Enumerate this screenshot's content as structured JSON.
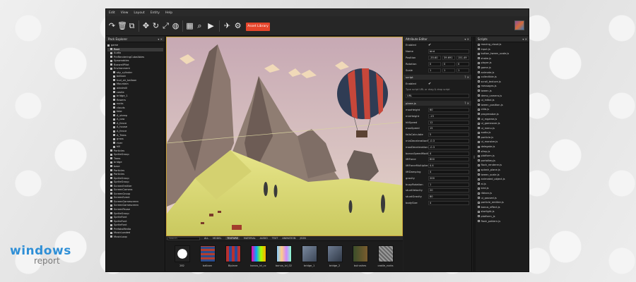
{
  "branding": {
    "logo_main": "windows",
    "logo_sub": "report"
  },
  "menubar": {
    "items": [
      "Edit",
      "View",
      "Layout",
      "Entity",
      "Help"
    ]
  },
  "toolbar": {
    "icons": [
      "redo-icon",
      "delete-icon",
      "copy-icon",
      "move-icon",
      "rotate-icon",
      "scale-icon",
      "globe-icon",
      "grid-icon",
      "zoom-icon",
      "play-icon",
      "publish-icon",
      "settings-icon"
    ],
    "asset_library_label": "Asset Library"
  },
  "hierarchy": {
    "title": "Pack Explorer",
    "items": [
      "game",
      "Root",
      "Audio",
      "PreRenderingCubeAbles",
      "Spawnables",
      "BoxwallPilot",
      "Environment",
      "sky_cylinder",
      "balloon",
      "hud_air_balloon",
      "Mountain",
      "windmill",
      "castle",
      "bridge_1",
      "flowers",
      "rocks",
      "clouds",
      "fake",
      "A_sheep",
      "A_cow",
      "A_fence",
      "A_house",
      "A_fence",
      "A_Trees",
      "grass",
      "river",
      "hill",
      "Particles",
      "SpriteGroup",
      "Trees",
      "bridge",
      "base",
      "Particles",
      "Particles",
      "SpriteGroup",
      "SpriteGroup",
      "ScreenEmitter",
      "ScreenCamera",
      "ScreenGroup",
      "ScreenEvent",
      "ScreenGamescreen",
      "ScreenGamescreen",
      "ScreenPause",
      "SpriteGroup",
      "SpriteFont",
      "SpriteFont",
      "SpriteFont",
      "PrefabsMedia",
      "MusicLoaded",
      "MusicLoop"
    ]
  },
  "assets": {
    "search_label": "Search",
    "tabs": [
      "ALL",
      "MODEL",
      "TEXTURE",
      "MATERIAL",
      "AUDIO",
      "TEXT",
      "ANIMATION",
      "JSON"
    ],
    "active_tab": "TEXTURE",
    "items": [
      {
        "name": "282"
      },
      {
        "name": "balloon"
      },
      {
        "name": "Biplane"
      },
      {
        "name": "bonus_lvl_cc"
      },
      {
        "name": "bonus_lvl_02"
      },
      {
        "name": "bridge_1"
      },
      {
        "name": "bridge_2"
      },
      {
        "name": "bulrushes"
      },
      {
        "name": "castle_rocks"
      }
    ]
  },
  "attributes": {
    "title": "Attribute Editor",
    "entity_rows": [
      {
        "label": "Enabled",
        "value": "✔"
      },
      {
        "label": "Name",
        "value": "bird"
      },
      {
        "label": "Position",
        "values": [
          "-35.60",
          "39.691",
          "151.49"
        ]
      },
      {
        "label": "Rotation",
        "values": [
          "0",
          "0",
          "0"
        ]
      },
      {
        "label": "Scale",
        "values": [
          "1",
          "1",
          "1"
        ]
      }
    ],
    "script_section": "script",
    "script_enabled_label": "Enabled",
    "script_enabled_value": "✔",
    "script_hint": "Type script URL or drag & drop script",
    "script_url": "URL",
    "component_section": "plane.js",
    "component_rows": [
      {
        "label": "maxHeight",
        "value": "60"
      },
      {
        "label": "minHeight",
        "value": "-15"
      },
      {
        "label": "hitSpeed",
        "value": "12"
      },
      {
        "label": "maxSpeed",
        "value": "15"
      },
      {
        "label": "fallsCalculate",
        "value": "5"
      },
      {
        "label": "minDecelerationFact",
        "value": "-0.3"
      },
      {
        "label": "maxDecelerationFact",
        "value": "-0.3"
      },
      {
        "label": "bonusSpeedModifier",
        "value": "4"
      },
      {
        "label": "liftForce",
        "value": "800"
      },
      {
        "label": "liftForceMultiplier",
        "value": "4.4"
      },
      {
        "label": "liftDamping",
        "value": "4"
      },
      {
        "label": "gravity",
        "value": "200"
      },
      {
        "label": "buoyRotation",
        "value": "1"
      },
      {
        "label": "stuntVelocity",
        "value": "20"
      },
      {
        "label": "stuntGravity",
        "value": "80"
      },
      {
        "label": "bodySize",
        "value": "4"
      }
    ]
  },
  "scripts": {
    "title": "Scripts",
    "items": [
      "moving_cloud.js",
      "input.js",
      "button_tween_scale.js",
      "shake.js",
      "player.js",
      "game.js",
      "animate.js",
      "collectible.js",
      "scroll_texture.js",
      "messages.js",
      "tween.js",
      "demo_camera.js",
      "ui_initial.js",
      "tween_position.js",
      "ctlib.js",
      "progressbar.js",
      "ui_mgame.js",
      "ui_gameover.js",
      "ui_menu.js",
      "audio.js",
      "particle.js",
      "ui_monster.js",
      "delegate.js",
      "sfmp.js",
      "platform.js",
      "portalkey.js",
      "flock_renderer.js",
      "splash_plane.js",
      "tween_scale.js",
      "animated_object.js",
      "ai.js",
      "bird.js",
      "ribbon.js",
      "ui_paused.js",
      "particle_emitter.js",
      "bonus_effect.js",
      "starlight.js",
      "platform_js",
      "flash_pattern.js"
    ]
  }
}
